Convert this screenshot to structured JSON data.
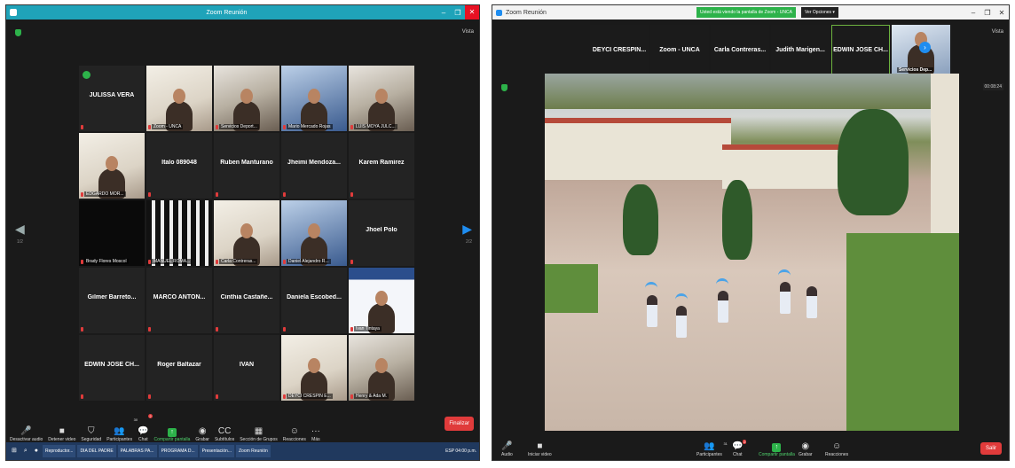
{
  "left_window": {
    "title": "Zoom Reunión",
    "controls": {
      "min": "–",
      "max": "❐",
      "close": "✕"
    },
    "view_label": "Vista",
    "page_left": "1/2",
    "page_right": "2/2",
    "participants": [
      {
        "name": "JULISSA VERA",
        "label": "",
        "video": "none"
      },
      {
        "name": "",
        "label": "Zoom - UNCA",
        "video": "warm"
      },
      {
        "name": "",
        "label": "Servicios Deport...",
        "video": "room"
      },
      {
        "name": "",
        "label": "Mario Mercado Rojas",
        "video": "blue",
        "highlight": true
      },
      {
        "name": "",
        "label": "LUIS MOYA JULC...",
        "video": "room"
      },
      {
        "name": "",
        "label": "EDGARDO MOR...",
        "video": "warm"
      },
      {
        "name": "Italo 089048",
        "label": "",
        "video": "none"
      },
      {
        "name": "Ruben Manturano",
        "label": "",
        "video": "none"
      },
      {
        "name": "Jheimi Mendoza...",
        "label": "",
        "video": "none"
      },
      {
        "name": "Karem Ramirez",
        "label": "",
        "video": "none"
      },
      {
        "name": "",
        "label": "Brady Flores Moscol",
        "video": "dark"
      },
      {
        "name": "",
        "label": "MANUEL ROMA...",
        "video": "stripe"
      },
      {
        "name": "",
        "label": "Carla Contreras...",
        "video": "warm"
      },
      {
        "name": "",
        "label": "Daniel Alejandro R...",
        "video": "blue"
      },
      {
        "name": "Jhoel Polo",
        "label": "",
        "video": "none"
      },
      {
        "name": "Gilmer Barreto...",
        "label": "",
        "video": "none"
      },
      {
        "name": "MARCO ANTON...",
        "label": "",
        "video": "none"
      },
      {
        "name": "Cinthia Castañe...",
        "label": "",
        "video": "none"
      },
      {
        "name": "Daniela Escobed...",
        "label": "",
        "video": "none"
      },
      {
        "name": "",
        "label": "Ivan Tintaya",
        "video": "card"
      },
      {
        "name": "EDWIN JOSE CH...",
        "label": "",
        "video": "none"
      },
      {
        "name": "Roger Baltazar",
        "label": "",
        "video": "none"
      },
      {
        "name": "IVAN",
        "label": "",
        "video": "none"
      },
      {
        "name": "",
        "label": "DEYCI CRESPIN E...",
        "video": "warm"
      },
      {
        "name": "",
        "label": "Henry & Ada M.",
        "video": "room"
      }
    ],
    "toolbar": [
      {
        "icon": "🎤",
        "label": "Desactivar audio"
      },
      {
        "icon": "■",
        "label": "Detener video"
      },
      {
        "icon": "⛉",
        "label": "Seguridad"
      },
      {
        "icon": "👥",
        "label": "Participantes",
        "count": "30"
      },
      {
        "icon": "💬",
        "label": "Chat",
        "badge": "2"
      },
      {
        "icon": "↑",
        "label": "Compartir pantalla",
        "green": true
      },
      {
        "icon": "◉",
        "label": "Grabar"
      },
      {
        "icon": "CC",
        "label": "Subtítulos"
      },
      {
        "icon": "▦",
        "label": "Sección de Grupos"
      },
      {
        "icon": "☺",
        "label": "Reacciones"
      },
      {
        "icon": "···",
        "label": "Más"
      }
    ],
    "end_button": "Finalizar",
    "taskbar": {
      "items": [
        "Reproductor...",
        "DIA DEL PADRE",
        "PALABRAS PA...",
        "PROGRAMA D...",
        "Presentación...",
        "Zoom Reunión"
      ],
      "tray": "ESP  04:00 p.m."
    }
  },
  "right_window": {
    "title": "Zoom Reunión",
    "share_banner": "Usted está viendo la pantalla de Zoom - UNCA",
    "view_options": "Ver Opciones ▾",
    "controls": {
      "min": "–",
      "max": "❐",
      "close": "✕"
    },
    "view_label": "Vista",
    "strip": [
      "DEYCI CRESPIN...",
      "Zoom - UNCA",
      "Carla Contreras...",
      "Judith Marigen...",
      "EDWIN JOSE CH..."
    ],
    "strip_video_label": "Servicios Dep...",
    "next_icon": "›",
    "timer": "00:08:24",
    "toolbar": [
      {
        "icon": "🎤",
        "label": "Audio"
      },
      {
        "icon": "■",
        "label": "Iniciar video"
      },
      {
        "icon": "👥",
        "label": "Participantes",
        "count": "31"
      },
      {
        "icon": "💬",
        "label": "Chat",
        "badge": "2"
      },
      {
        "icon": "↑",
        "label": "Compartir pantalla",
        "green": true
      },
      {
        "icon": "◉",
        "label": "Grabar"
      },
      {
        "icon": "☺",
        "label": "Reacciones"
      }
    ],
    "leave_button": "Salir"
  }
}
